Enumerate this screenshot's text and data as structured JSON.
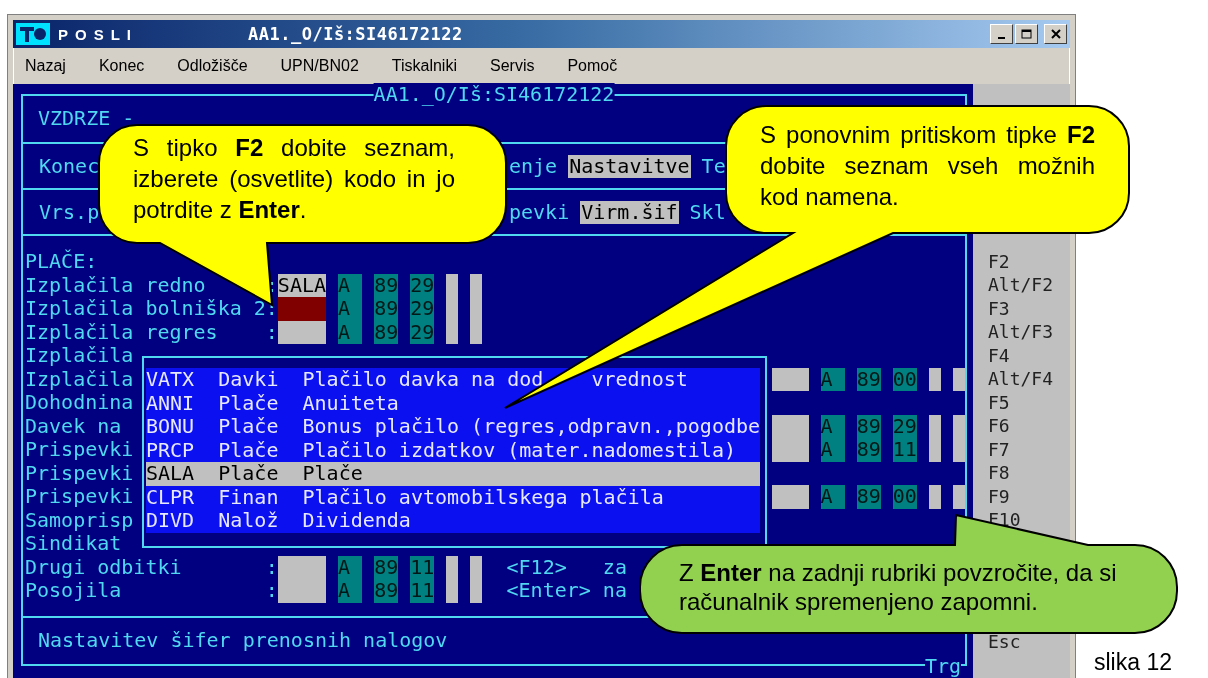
{
  "window": {
    "app_name": "POSLI",
    "title": "AA1._O/Iš:SI46172122"
  },
  "menu": [
    "Nazaj",
    "Konec",
    "Odložišče",
    "UPN/BN02",
    "Tiskalniki",
    "Servis",
    "Pomoč"
  ],
  "terminal": {
    "frame_title": "AA1._O/Iš:SI46172122",
    "header": "VZDRZE -",
    "menu_rows": [
      {
        "items": [
          {
            "label": "Konec",
            "selected": false
          },
          {
            "label": "enje",
            "selected": false
          },
          {
            "label": "Nastavitve",
            "selected": true
          },
          {
            "label": "Te",
            "selected": false
          }
        ]
      },
      {
        "items": [
          {
            "label": "Vrs.p",
            "selected": false
          },
          {
            "label": "pevki",
            "selected": false
          },
          {
            "label": "Virm.šif",
            "selected": true
          },
          {
            "label": "Skl",
            "selected": false
          }
        ]
      }
    ],
    "section_title": "PLAČE:",
    "rows": [
      {
        "kind": "field_row",
        "label": "Izplačila redno",
        "separator": ":",
        "code": {
          "value": "SALA",
          "focused": false
        },
        "flags": [
          "A",
          "89",
          "29"
        ]
      },
      {
        "kind": "field_row",
        "label": "Izplačila bolniška 2",
        "separator": ":",
        "code": {
          "focused": true
        },
        "flags": [
          "A",
          "89",
          "29"
        ]
      },
      {
        "kind": "field_row",
        "label": "Izplačila regres",
        "separator": ":",
        "code": {
          "focused": false
        },
        "flags": [
          "A",
          "89",
          "29"
        ]
      },
      {
        "kind": "label_row",
        "label": "Izplačila"
      },
      {
        "kind": "covered_row",
        "label": "Izplačila",
        "code": {
          "focused": false
        },
        "flags": [
          "A",
          "89",
          "00"
        ]
      },
      {
        "kind": "label_row",
        "label": "Dohodnina"
      },
      {
        "kind": "covered_row",
        "label": "Davek na",
        "code": {
          "focused": false
        },
        "flags": [
          "A",
          "89",
          "29"
        ]
      },
      {
        "kind": "covered_row",
        "label": "Prispevki",
        "code": {
          "focused": false
        },
        "flags": [
          "A",
          "89",
          "11"
        ]
      },
      {
        "kind": "label_row",
        "label": "Prispevki"
      },
      {
        "kind": "covered_row",
        "label": "Prispevki",
        "code": {
          "focused": false
        },
        "flags": [
          "A",
          "89",
          "00"
        ]
      },
      {
        "kind": "label_row",
        "label": "Samoprisp"
      },
      {
        "kind": "label_row",
        "label": "Sindikat"
      },
      {
        "kind": "field_row",
        "label": "Drugi odbitki",
        "separator": ":",
        "code": {
          "focused": false
        },
        "flags": [
          "A",
          "89",
          "11"
        ],
        "hint": "<F12>   za"
      },
      {
        "kind": "field_row",
        "label": "Posojila",
        "separator": ":",
        "code": {
          "focused": false
        },
        "flags": [
          "A",
          "89",
          "11"
        ],
        "hint": "<Enter> na"
      }
    ],
    "popup": {
      "items": [
        {
          "code": "VATX",
          "group": "Davki",
          "description": "Plačilo davka na dod",
          "description_tail": "vrednost",
          "selected": false
        },
        {
          "code": "ANNI",
          "group": "Plače",
          "description": "Anuiteta",
          "selected": false
        },
        {
          "code": "BONU",
          "group": "Plače",
          "description": "Bonus plačilo (regres,odpravn.,pogodbe",
          "selected": false
        },
        {
          "code": "PRCP",
          "group": "Plače",
          "description": "Plačilo izdatkov (mater.nadomestila)",
          "selected": false
        },
        {
          "code": "SALA",
          "group": "Plače",
          "description": "Plače",
          "selected": true
        },
        {
          "code": "CLPR",
          "group": "Finan",
          "description": "Plačilo avtomobilskega plačila",
          "selected": false
        },
        {
          "code": "DIVD",
          "group": "Nalož",
          "description": "Dividenda",
          "selected": false
        }
      ]
    },
    "status": "Nastavitev šifer prenosnih nalogov",
    "frame_footer": "Trg"
  },
  "function_keys": [
    "F2",
    "Alt/F2",
    "F3",
    "Alt/F3",
    "F4",
    "Alt/F4",
    "F5",
    "F6",
    "F7",
    "F8",
    "F9",
    "F10"
  ],
  "exit_key": "Esc",
  "callouts": [
    {
      "text": "S tipko **F2** dobite seznam, izberete (osvetlite) kodo in jo potrdite z **Enter**.",
      "color": "#ffff00"
    },
    {
      "text": "S ponovnim pritiskom tipke **F2** dobite seznam vseh možnih kod namena.",
      "color": "#ffff00"
    },
    {
      "text": "Z **Enter** na zadnji rubriki povzročite, da si računalnik spremenjeno zapomni.",
      "color": "#92d050"
    }
  ],
  "caption": "slika 12"
}
